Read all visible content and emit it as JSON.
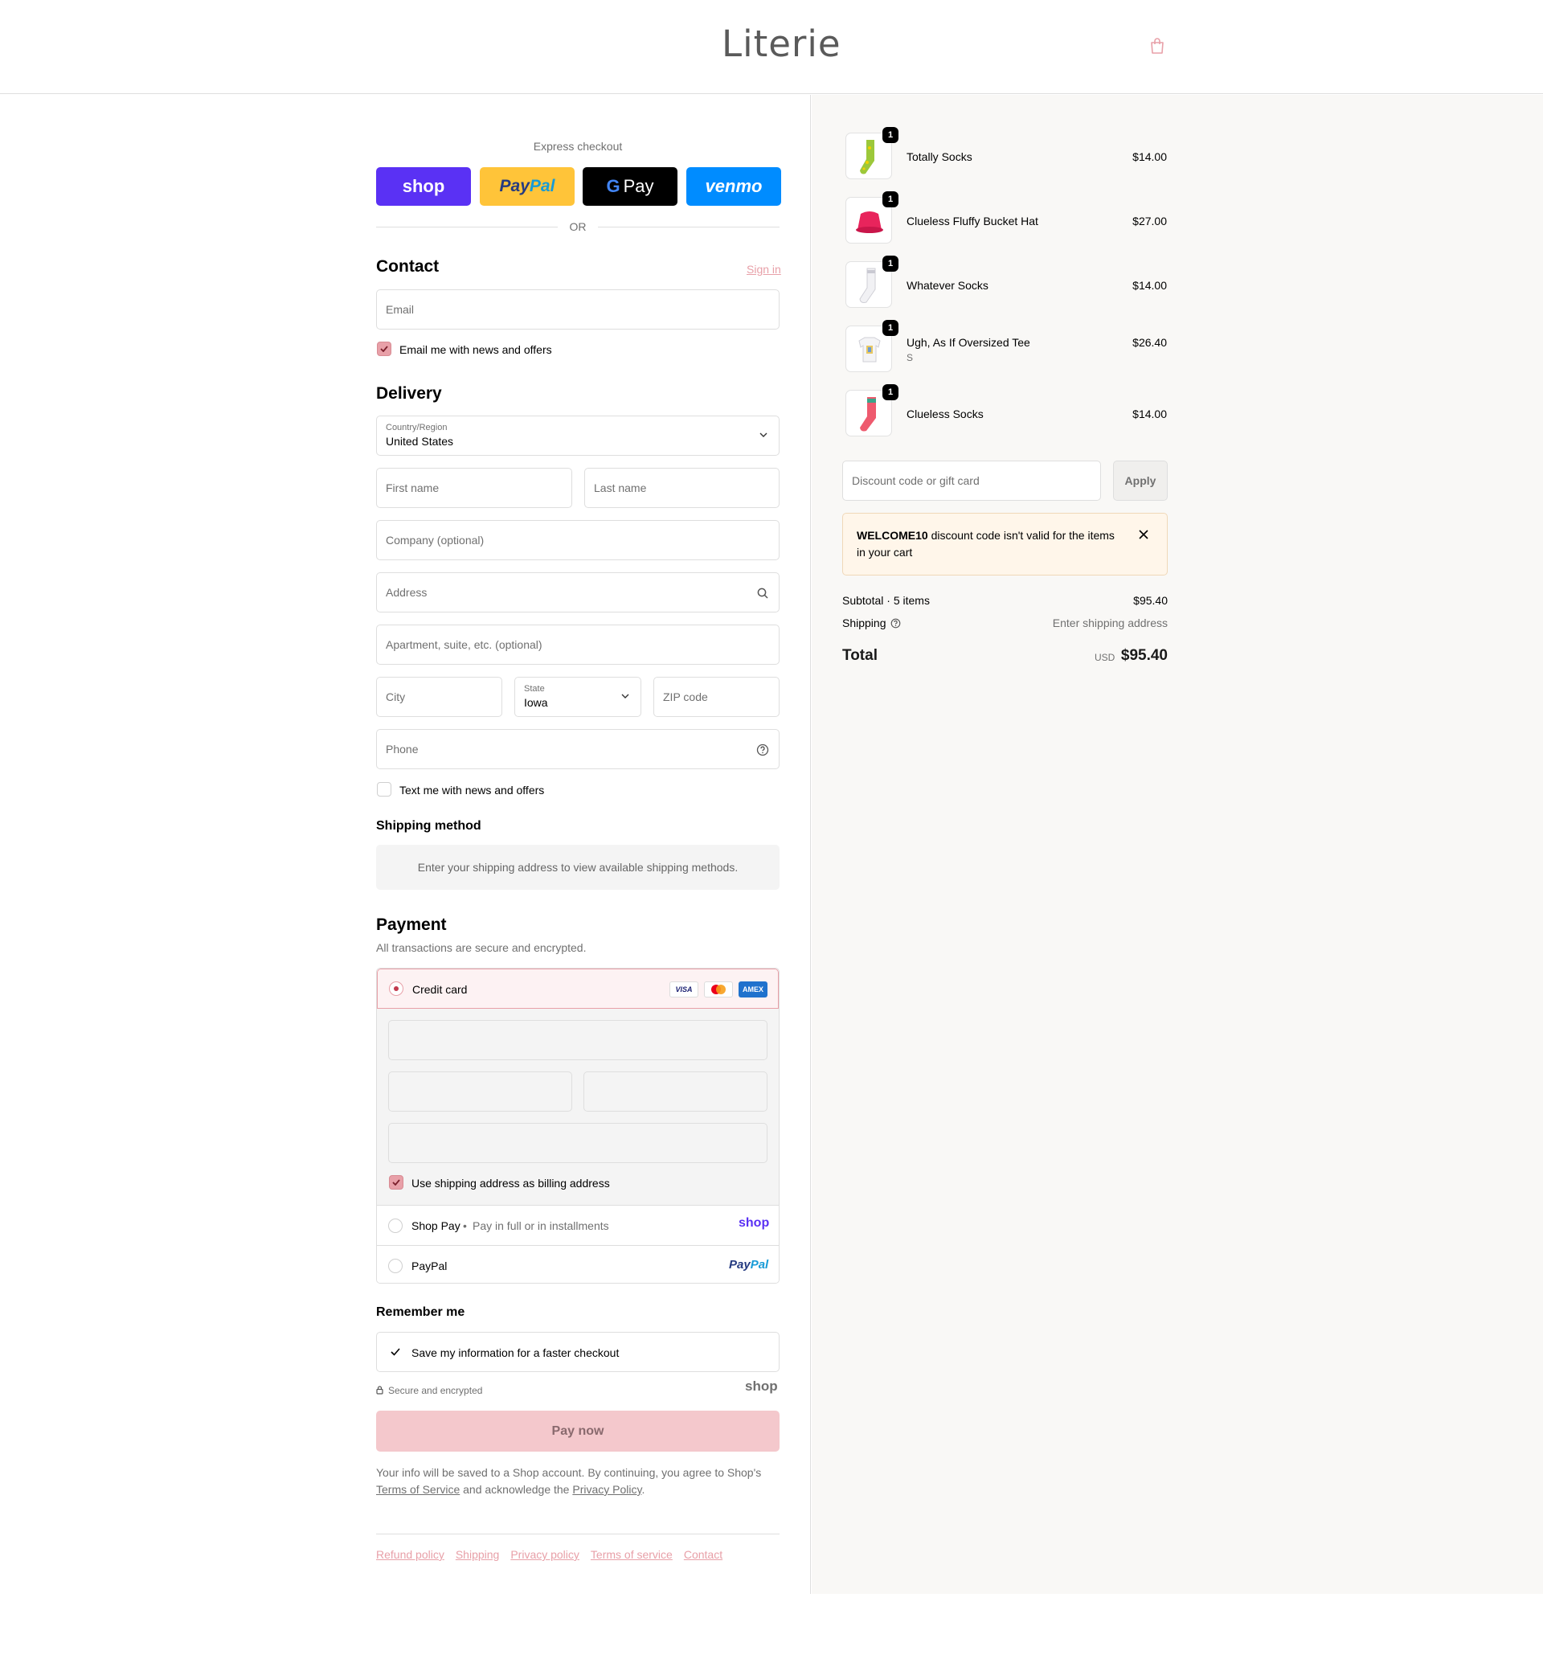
{
  "header": {
    "logo": "Literie",
    "cart_icon": "shopping-bag-icon"
  },
  "express": {
    "label": "Express checkout",
    "buttons": {
      "shop": "shop",
      "paypal_a": "Pay",
      "paypal_b": "Pal",
      "gpay_g": "G",
      "gpay": "Pay",
      "venmo": "venmo"
    },
    "or": "OR"
  },
  "contact": {
    "title": "Contact",
    "sign_in": "Sign in",
    "email_placeholder": "Email",
    "email_news": "Email me with news and offers"
  },
  "delivery": {
    "title": "Delivery",
    "country_label": "Country/Region",
    "country_value": "United States",
    "first_name": "First name",
    "last_name": "Last name",
    "company": "Company (optional)",
    "address": "Address",
    "apartment": "Apartment, suite, etc. (optional)",
    "city": "City",
    "state_label": "State",
    "state_value": "Iowa",
    "zip": "ZIP code",
    "phone": "Phone",
    "text_news": "Text me with news and offers"
  },
  "shipping_method": {
    "title": "Shipping method",
    "info": "Enter your shipping address to view available shipping methods."
  },
  "payment": {
    "title": "Payment",
    "subtitle": "All transactions are secure and encrypted.",
    "credit_card": "Credit card",
    "card_logos": {
      "visa": "VISA",
      "amex": "AMEX"
    },
    "billing_same": "Use shipping address as billing address",
    "shop_pay": "Shop Pay",
    "shop_pay_sub": "Pay in full or in installments",
    "shop_pay_logo": "shop",
    "paypal": "PayPal",
    "paypal_logo_a": "Pay",
    "paypal_logo_b": "Pal"
  },
  "remember": {
    "title": "Remember me",
    "save_info": "Save my information for a faster checkout",
    "secure": "Secure and encrypted",
    "shop_logo": "shop"
  },
  "pay_now": "Pay now",
  "legal": {
    "text1": "Your info will be saved to a Shop account. By continuing, you agree to Shop's",
    "terms": "Terms of Service",
    "text2": "and acknowledge the",
    "privacy": "Privacy Policy",
    "text3": "."
  },
  "footer": {
    "links": [
      "Refund policy",
      "Shipping",
      "Privacy policy",
      "Terms of service",
      "Contact"
    ]
  },
  "cart": {
    "items": [
      {
        "name": "Totally Socks",
        "variant": "",
        "price": "$14.00",
        "qty": "1"
      },
      {
        "name": "Clueless Fluffy Bucket Hat",
        "variant": "",
        "price": "$27.00",
        "qty": "1"
      },
      {
        "name": "Whatever Socks",
        "variant": "",
        "price": "$14.00",
        "qty": "1"
      },
      {
        "name": "Ugh, As If Oversized Tee",
        "variant": "S",
        "price": "$26.40",
        "qty": "1"
      },
      {
        "name": "Clueless Socks",
        "variant": "",
        "price": "$14.00",
        "qty": "1"
      }
    ],
    "discount_placeholder": "Discount code or gift card",
    "apply": "Apply",
    "alert_code": "WELCOME10",
    "alert_text": "discount code isn't valid for the items in your cart",
    "subtotal_label": "Subtotal · 5 items",
    "subtotal_value": "$95.40",
    "shipping_label": "Shipping",
    "shipping_value": "Enter shipping address",
    "total_label": "Total",
    "currency": "USD",
    "total_value": "$95.40"
  },
  "colors": {
    "accent": "#e8a0a8",
    "shop_purple": "#5a31f4",
    "paypal_yellow": "#ffc439",
    "venmo_blue": "#008cff",
    "alert_bg": "#fff6ea"
  }
}
